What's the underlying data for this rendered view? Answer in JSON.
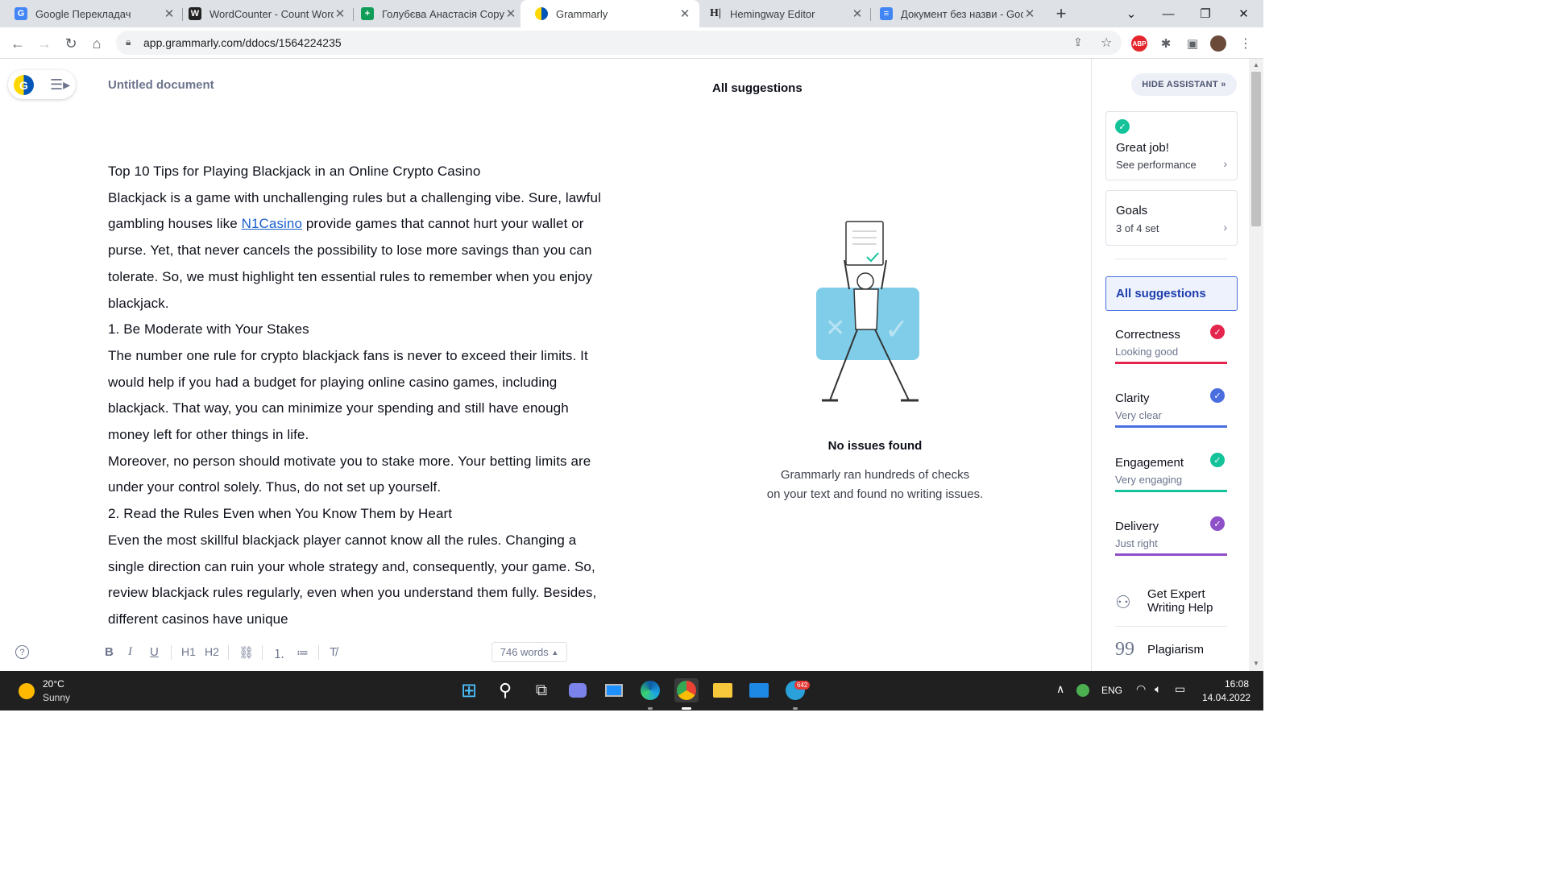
{
  "browser": {
    "tabs": [
      {
        "title": "Google Перекладач",
        "icon": "google-translate-icon",
        "color": "#4285f4",
        "glyph": "G"
      },
      {
        "title": "WordCounter - Count Words",
        "icon": "wordcounter-icon",
        "color": "#222222",
        "glyph": "W"
      },
      {
        "title": "Голубєва Анастасія Copyw",
        "icon": "google-sheets-icon",
        "color": "#0f9d58",
        "glyph": "+"
      },
      {
        "title": "Grammarly",
        "icon": "grammarly-icon",
        "color": "#15c39a",
        "glyph": "G"
      },
      {
        "title": "Hemingway Editor",
        "icon": "hemingway-icon",
        "color": "#ffffff",
        "glyph": "H|"
      },
      {
        "title": "Документ без назви - Goo",
        "icon": "google-docs-icon",
        "color": "#4285f4",
        "glyph": "≡"
      }
    ],
    "new_tab": "+",
    "url": "app.grammarly.com/ddocs/1564224235",
    "extension_abp": "ABP"
  },
  "editor": {
    "doc_title": "Untitled document",
    "paragraphs": [
      {
        "text": "Top 10 Tips for Playing Blackjack in an Online Crypto Casino"
      },
      {
        "before": "Blackjack is a game with unchallenging rules but a challenging vibe. Sure, lawful gambling houses like ",
        "link": "N1Casino",
        "after": " provide games that cannot hurt your wallet or purse. Yet, that never cancels the possibility to lose more savings than you can tolerate. So, we must highlight ten essential rules to remember when you enjoy blackjack."
      },
      {
        "text": "1. Be Moderate with Your Stakes"
      },
      {
        "text": "The number one rule for crypto blackjack fans is never to exceed their limits. It would help if you had a budget for playing online casino games, including blackjack. That way, you can minimize your spending and still have enough money left for other things in life."
      },
      {
        "text": "Moreover, no person should motivate you to stake more. Your betting limits are under your control solely. Thus, do not set up yourself."
      },
      {
        "text": "2. Read the Rules Even when You Know Them by Heart"
      },
      {
        "text": "Even the most skillful blackjack player cannot know all the rules. Changing a single direction can ruin your whole strategy and, consequently, your game. So, review blackjack rules regularly, even when you understand them fully. Besides, different casinos have unique"
      }
    ],
    "toolbar": {
      "bold": "B",
      "italic": "I",
      "underline": "U",
      "h1": "H1",
      "h2": "H2",
      "link_icon": "link-icon",
      "ol_icon": "ordered-list-icon",
      "ul_icon": "bullet-list-icon",
      "clear_icon": "clear-format-icon",
      "help": "?"
    },
    "word_count": "746 words"
  },
  "suggestions": {
    "header": "All suggestions",
    "no_issues_title": "No issues found",
    "no_issues_line1": "Grammarly ran hundreds of checks",
    "no_issues_line2": "on your text and found no writing issues."
  },
  "assistant": {
    "hide_label": "HIDE ASSISTANT",
    "perf_title": "Great job!",
    "perf_sub": "See performance",
    "goals_title": "Goals",
    "goals_sub": "3 of 4 set",
    "all_suggestions": "All suggestions",
    "metrics": [
      {
        "name": "Correctness",
        "status": "Looking good",
        "color": "#e5254e"
      },
      {
        "name": "Clarity",
        "status": "Very clear",
        "color": "#4a6ee0"
      },
      {
        "name": "Engagement",
        "status": "Very engaging",
        "color": "#15c39a"
      },
      {
        "name": "Delivery",
        "status": "Just right",
        "color": "#8e50c8"
      }
    ],
    "expert_line1": "Get Expert",
    "expert_line2": "Writing Help",
    "plagiarism": "Plagiarism"
  },
  "taskbar": {
    "temp": "20°C",
    "condition": "Sunny",
    "lang": "ENG",
    "time": "16:08",
    "date": "14.04.2022",
    "telegram_badge": "642"
  }
}
